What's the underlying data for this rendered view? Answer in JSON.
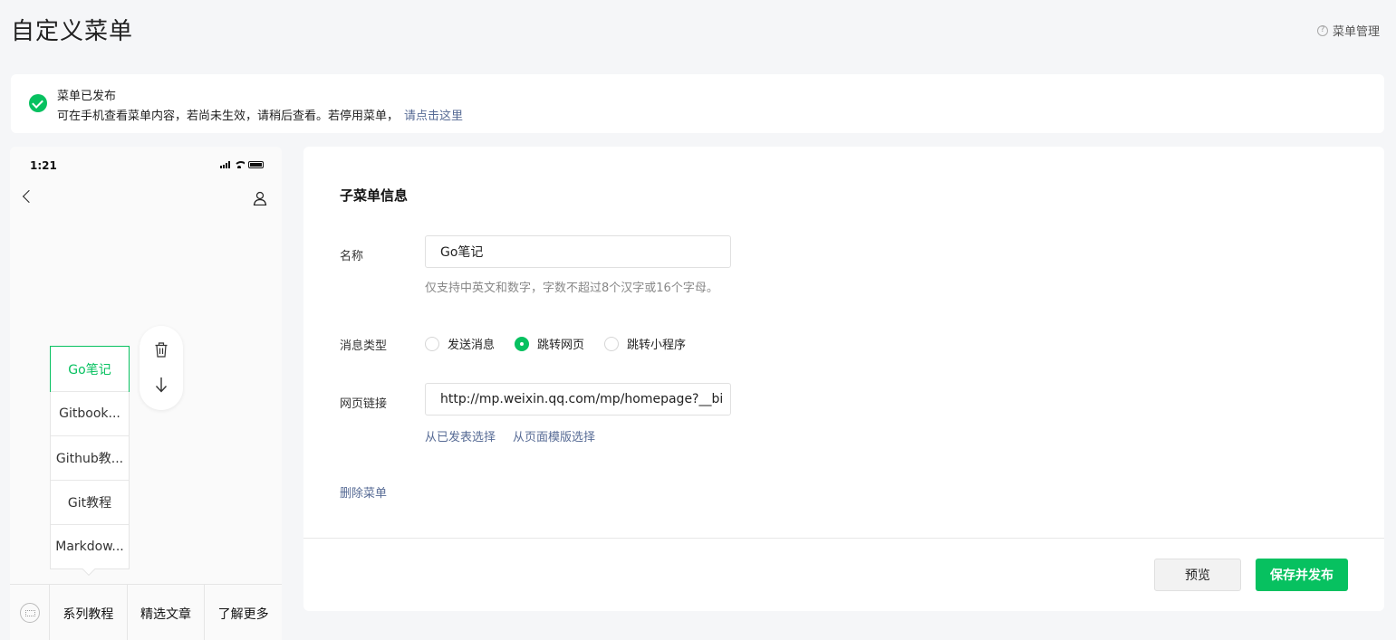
{
  "page": {
    "title": "自定义菜单",
    "help_label": "菜单管理"
  },
  "notice": {
    "title": "菜单已发布",
    "text": "可在手机查看菜单内容，若尚未生效，请稍后查看。若停用菜单，",
    "link": "请点击这里"
  },
  "phone": {
    "time": "1:21",
    "submenu": [
      "Go笔记",
      "Gitbook...",
      "Github教...",
      "Git教程",
      "Markdow..."
    ],
    "active_submenu_index": 0,
    "bottom_menu": [
      "系列教程",
      "精选文章",
      "了解更多"
    ]
  },
  "form": {
    "heading": "子菜单信息",
    "name_label": "名称",
    "name_value": "Go笔记",
    "name_hint": "仅支持中英文和数字，字数不超过8个汉字或16个字母。",
    "type_label": "消息类型",
    "types": [
      "发送消息",
      "跳转网页",
      "跳转小程序"
    ],
    "selected_type_index": 1,
    "url_label": "网页链接",
    "url_value": "http://mp.weixin.qq.com/mp/homepage?__bi",
    "url_links": [
      "从已发表选择",
      "从页面模版选择"
    ],
    "delete_label": "删除菜单"
  },
  "actions": {
    "preview": "预览",
    "publish": "保存并发布"
  },
  "colors": {
    "accent": "#07c160",
    "link": "#576b95"
  },
  "icons": [
    "check-circle-icon",
    "help-icon",
    "back-icon",
    "user-icon",
    "trash-icon",
    "arrow-down-icon",
    "keyboard-icon"
  ]
}
